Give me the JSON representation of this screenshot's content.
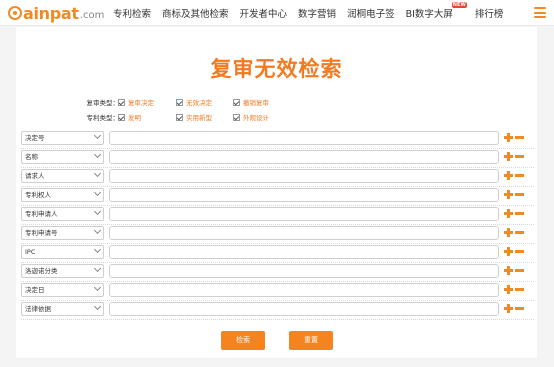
{
  "brand": {
    "logo_text": "ainpat",
    "logo_suffix": ".com"
  },
  "nav": {
    "items": [
      {
        "label": "专利检索"
      },
      {
        "label": "商标及其他检索"
      },
      {
        "label": "开发者中心"
      },
      {
        "label": "数字营销"
      },
      {
        "label": "润桐电子签"
      },
      {
        "label": "BI数字大屏",
        "badge": "NEW"
      },
      {
        "label": "排行榜"
      }
    ]
  },
  "page": {
    "title": "复审无效检索",
    "filters": [
      {
        "label": "复审类型：",
        "options": [
          "复审决定",
          "无效决定",
          "撤销复审"
        ]
      },
      {
        "label": "专利类型：",
        "options": [
          "发明",
          "实用新型",
          "外观设计"
        ]
      }
    ],
    "fields": [
      {
        "select": "决定号"
      },
      {
        "select": "名称"
      },
      {
        "select": "请求人"
      },
      {
        "select": "专利权人"
      },
      {
        "select": "专利申请人"
      },
      {
        "select": "专利申请号"
      },
      {
        "select": "IPC"
      },
      {
        "select": "洛迦诺分类"
      },
      {
        "select": "决定日"
      },
      {
        "select": "法律依据"
      }
    ],
    "search_button": "检索",
    "reset_button": "重置"
  },
  "colors": {
    "accent": "#f27a23",
    "button": "#f5841f"
  }
}
